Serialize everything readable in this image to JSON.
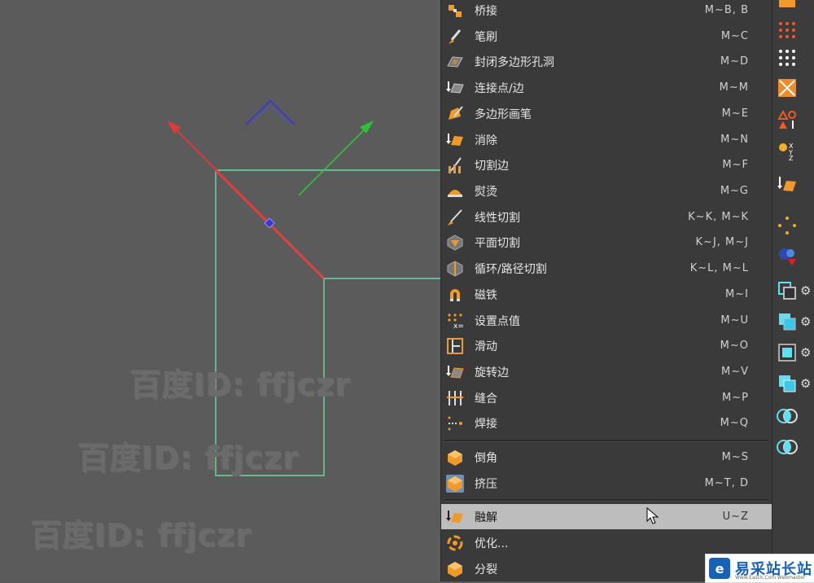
{
  "viewport": {
    "watermarks": [
      "百度ID: ffjczr",
      "百度ID: ffjczr",
      "百度ID: ffjczr"
    ]
  },
  "menu": {
    "items": [
      {
        "label": "桥接",
        "shortcut": "M~B, B",
        "icon": "bridge-icon"
      },
      {
        "label": "笔刷",
        "shortcut": "M~C",
        "icon": "brush-icon"
      },
      {
        "label": "封闭多边形孔洞",
        "shortcut": "M~D",
        "icon": "close-polygon-hole-icon"
      },
      {
        "label": "连接点/边",
        "shortcut": "M~M",
        "icon": "connect-points-edges-icon"
      },
      {
        "label": "多边形画笔",
        "shortcut": "M~E",
        "icon": "polygon-pen-icon"
      },
      {
        "label": "消除",
        "shortcut": "M~N",
        "icon": "dissolve-icon"
      },
      {
        "label": "切割边",
        "shortcut": "M~F",
        "icon": "edge-cut-icon"
      },
      {
        "label": "熨烫",
        "shortcut": "M~G",
        "icon": "iron-icon"
      },
      {
        "label": "线性切割",
        "shortcut": "K~K, M~K",
        "icon": "line-cut-icon"
      },
      {
        "label": "平面切割",
        "shortcut": "K~J, M~J",
        "icon": "plane-cut-icon"
      },
      {
        "label": "循环/路径切割",
        "shortcut": "K~L, M~L",
        "icon": "loop-path-cut-icon"
      },
      {
        "label": "磁铁",
        "shortcut": "M~I",
        "icon": "magnet-icon"
      },
      {
        "label": "设置点值",
        "shortcut": "M~U",
        "icon": "set-point-value-icon"
      },
      {
        "label": "滑动",
        "shortcut": "M~O",
        "icon": "slide-icon"
      },
      {
        "label": "旋转边",
        "shortcut": "M~V",
        "icon": "spin-edge-icon"
      },
      {
        "label": "缝合",
        "shortcut": "M~P",
        "icon": "stitch-icon"
      },
      {
        "label": "焊接",
        "shortcut": "M~Q",
        "icon": "weld-icon"
      },
      {
        "label": "倒角",
        "shortcut": "M~S",
        "icon": "bevel-icon"
      },
      {
        "label": "挤压",
        "shortcut": "M~T, D",
        "icon": "extrude-icon"
      },
      {
        "label": "融解",
        "shortcut": "U~Z",
        "icon": "melt-icon"
      },
      {
        "label": "优化...",
        "shortcut": "",
        "icon": "optimize-icon"
      },
      {
        "label": "分裂",
        "shortcut": "",
        "icon": "split-icon"
      }
    ]
  },
  "logo": {
    "text": "易采站长站",
    "subtext": "Www.Easck.Com Webmaster"
  },
  "colors": {
    "menu_bg": "#3a3a3a",
    "highlight": "#bdbdbd",
    "viewport_bg": "#5b5b5b",
    "axis_x": "#e03a3a",
    "axis_y": "#2ec23a",
    "axis_z": "#4040c0",
    "polyline": "#6fd6a6"
  }
}
